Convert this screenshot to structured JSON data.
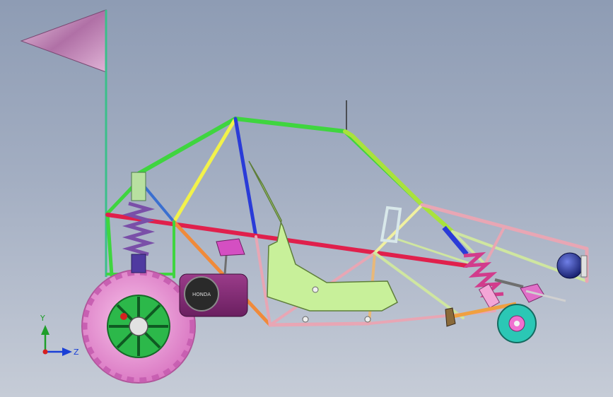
{
  "viewport": {
    "background_top": "#8e9cb4",
    "background_bottom": "#c6ccd7"
  },
  "triad": {
    "y_label": "Y",
    "z_label": "Z",
    "y_color": "#1f9e2a",
    "z_color": "#1a3fd6",
    "origin_color": "#d62020"
  },
  "engine": {
    "badge_text": "HONDA"
  },
  "colors": {
    "frame_green": "#3fd53f",
    "frame_lime": "#a9e23c",
    "frame_yellow": "#f2f24a",
    "frame_blue": "#2a3bd8",
    "frame_red": "#e0204c",
    "frame_orange": "#f08a3a",
    "frame_pink": "#e8a6b4",
    "frame_pale_green": "#cfe6a0",
    "seat": "#c8f09a",
    "tire": "#f09ad8",
    "rim": "#2cb84a",
    "flag": "#c080b0",
    "spring": "#d23c8c",
    "lamp": "#1c2a8c"
  }
}
